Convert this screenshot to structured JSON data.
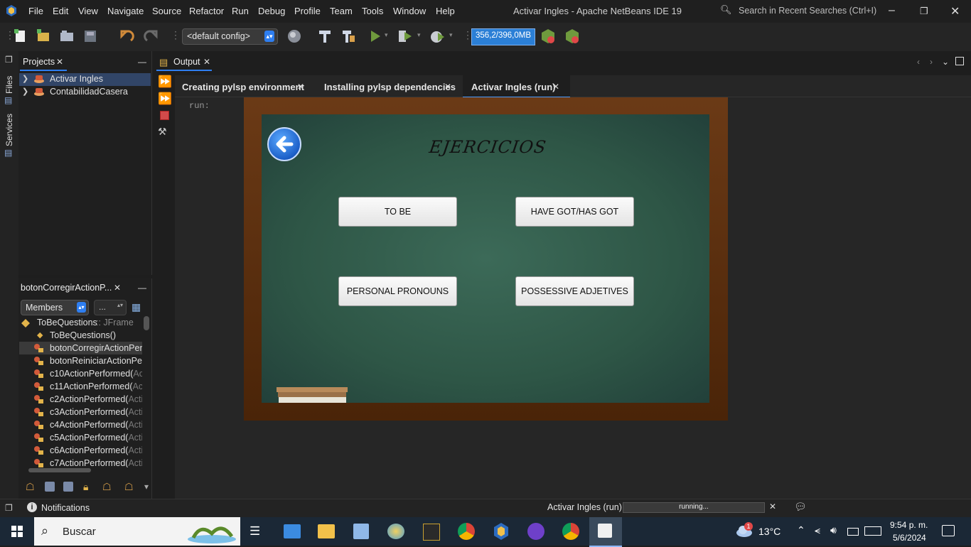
{
  "menu": [
    "File",
    "Edit",
    "View",
    "Navigate",
    "Source",
    "Refactor",
    "Run",
    "Debug",
    "Profile",
    "Team",
    "Tools",
    "Window",
    "Help"
  ],
  "window_title": "Activar Ingles - Apache NetBeans IDE 19",
  "search_placeholder": "Search in Recent Searches (Ctrl+I)",
  "toolbar": {
    "config": "<default config>",
    "memory": "356,2/396,0MB"
  },
  "side_tabs": {
    "files": "Files",
    "services": "Services"
  },
  "projects": {
    "tab": "Projects",
    "items": [
      "Activar Ingles",
      "ContabilidadCasera"
    ]
  },
  "navigator": {
    "tab": "botonCorregirActionP...",
    "filter": "Members",
    "filter2": "...",
    "root": "ToBeQuestions",
    "root_type": ":: JFrame",
    "items": [
      {
        "name": "ToBeQuestions()",
        "suffix": ""
      },
      {
        "name": "botonCorregirActionPerf",
        "suffix": ""
      },
      {
        "name": "botonReiniciarActionPer",
        "suffix": ""
      },
      {
        "name": "c10ActionPerformed(",
        "suffix": "Act"
      },
      {
        "name": "c11ActionPerformed(",
        "suffix": "Act"
      },
      {
        "name": "c2ActionPerformed(",
        "suffix": "Acti"
      },
      {
        "name": "c3ActionPerformed(",
        "suffix": "Acti"
      },
      {
        "name": "c4ActionPerformed(",
        "suffix": "Acti"
      },
      {
        "name": "c5ActionPerformed(",
        "suffix": "Acti"
      },
      {
        "name": "c6ActionPerformed(",
        "suffix": "Acti"
      },
      {
        "name": "c7ActionPerformed(",
        "suffix": "Acti"
      }
    ]
  },
  "output": {
    "tab": "Output",
    "subtabs": [
      "Creating pylsp environment",
      "Installing pylsp dependencies",
      "Activar Ingles (run)"
    ],
    "run_text": "run:"
  },
  "app": {
    "title": "EJERCICIOS",
    "buttons": [
      "TO BE",
      "HAVE GOT/HAS GOT",
      "PERSONAL PRONOUNS",
      "POSSESSIVE ADJETIVES"
    ]
  },
  "statusbar": {
    "notifications": "Notifications",
    "task": "Activar Ingles (run)",
    "progress": "running..."
  },
  "taskbar": {
    "search": "Buscar",
    "weather": "13°C",
    "time": "9:54 p. m.",
    "date": "5/6/2024",
    "weather_badge": "1"
  },
  "colors": {
    "accent": "#2e7ef0",
    "board": "#2e5646",
    "frame": "#5a2e0f"
  }
}
